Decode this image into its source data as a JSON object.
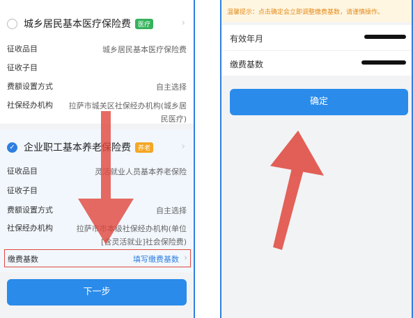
{
  "left_screen": {
    "item_a": {
      "title": "城乡居民基本医疗保险费",
      "tag": "医疗",
      "rows": [
        {
          "label": "征收品目",
          "value": "城乡居民基本医疗保险费"
        },
        {
          "label": "征收子目",
          "value": ""
        },
        {
          "label": "费额设置方式",
          "value": "自主选择"
        },
        {
          "label": "社保经办机构",
          "value": "拉萨市城关区社保经办机构(城乡居民医疗)"
        }
      ]
    },
    "item_b": {
      "title": "企业职工基本养老保险费",
      "tag": "养老",
      "rows": [
        {
          "label": "征收品目",
          "value": "灵活就业人员基本养老保险"
        },
        {
          "label": "征收子目",
          "value": ""
        },
        {
          "label": "费额设置方式",
          "value": "自主选择"
        },
        {
          "label": "社保经办机构",
          "value": "拉萨市市本级社保经办机构(单位[含灵活就业]社会保险费)"
        }
      ],
      "base_label": "缴费基数",
      "base_link": "填写缴费基数"
    },
    "next_button": "下一步"
  },
  "right_screen": {
    "notice": "温馨提示：点击确定会立即调整缴费基数，请谨慎操作。",
    "rows": [
      {
        "label": "有效年月"
      },
      {
        "label": "缴费基数"
      }
    ],
    "confirm_button": "确定"
  },
  "colors": {
    "primary_blue": "#2a8bea",
    "annotation_red": "#e0463c",
    "tag_green": "#36b35c",
    "tag_orange": "#f5a623"
  }
}
